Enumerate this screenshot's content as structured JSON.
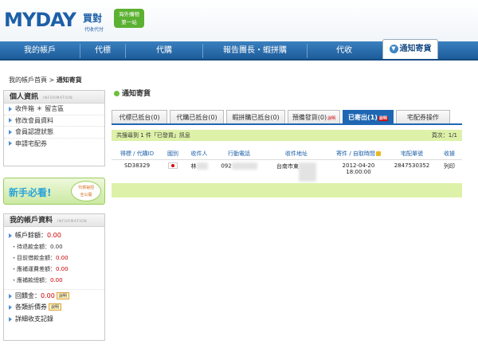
{
  "header": {
    "logo": "MYDAY",
    "logo_cn": "買對",
    "logo_sub": "代收代付",
    "badge_line1": "海外購物",
    "badge_line2": "第一站"
  },
  "nav": {
    "items": [
      "我的帳戶",
      "代標",
      "代購",
      "報告團長・蝦拼購",
      "代收"
    ],
    "active": "通知寄貨"
  },
  "breadcrumb": {
    "home": "我的帳戶首頁",
    "sep": ">",
    "current": "通知寄貨"
  },
  "sidebar": {
    "personal": {
      "title": "個人資訊",
      "title_en": "INFORMATION",
      "items": [
        "收件箱",
        "留言區",
        "修改會員資料",
        "會員認證狀態",
        "申請宅配券"
      ]
    },
    "newbie": {
      "label": "新手必看!",
      "bubble_line1": "代標祕招",
      "bubble_line2": "全公開"
    },
    "account": {
      "title": "我的帳戶資料",
      "title_en": "INFORMATION",
      "balance_label": "帳戶餘額：",
      "balance_value": "0.00",
      "pending_label": "待退款金額：",
      "pending_value": "0.00",
      "borrow_label": "目前借款金額：",
      "borrow_value": "0.00",
      "shipping_label": "應補運費差額：",
      "shipping_value": "0.00",
      "payment_label": "應補款總額：",
      "payment_value": "0.00",
      "rebate_label": "回饋金：",
      "rebate_value": "0.00",
      "help_label": "說明",
      "coupon_label": "各類折價券",
      "history_label": "詳細收支記錄"
    }
  },
  "main": {
    "title": "通知寄貨",
    "tabs": [
      {
        "label": "代標已抵台(0)"
      },
      {
        "label": "代購已抵台(0)"
      },
      {
        "label": "蝦拼購已抵台(0)"
      },
      {
        "label": "預備發貨(0)",
        "note": "說明"
      },
      {
        "label": "已寄出(1)",
        "note": "說明"
      },
      {
        "label": "宅配券操作"
      }
    ],
    "summary": "共搜尋到 1 件「已發貨」訊息",
    "page_info": "頁次：1/1",
    "columns": [
      "得標 / 代購ID",
      "國別",
      "收件人",
      "行動電話",
      "收件地址",
      "寄件 / 自取時間",
      "宅配單號",
      "收據"
    ],
    "rows": [
      {
        "id": "SD38329",
        "recipient": "林",
        "phone": "092",
        "address": "台南市東",
        "date": "2012-04-20",
        "time": "18:00:00",
        "tracking": "2847530352",
        "receipt": "列印"
      }
    ]
  }
}
